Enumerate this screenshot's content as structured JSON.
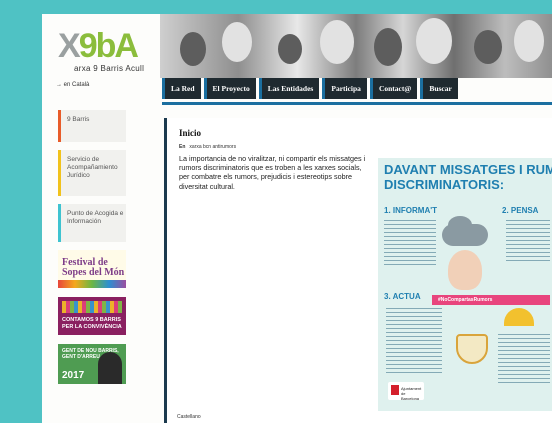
{
  "header": {
    "logo_mark": "X9bA",
    "logo_sub": "arxa 9 Barris Acull"
  },
  "language": "→ en Català",
  "nav": [
    "La Red",
    "El Proyecto",
    "Las Entidades",
    "Participa",
    "Contact@",
    "Buscar"
  ],
  "sidebar": {
    "items": [
      {
        "label": "9 Barris"
      },
      {
        "label": "Servicio de Acompañamiento Jurídico"
      },
      {
        "label": "Punto de Acogida e Información"
      }
    ],
    "promos": [
      {
        "text": "Festival de Sopes del Món"
      },
      {
        "text": "CONTAMOS 9 BARRIS PER LA CONVIVÈNCIA"
      },
      {
        "text": "GENT DE NOU BARRIS, GENT D'ARREU",
        "year": "2017"
      }
    ]
  },
  "content": {
    "title": "Inicio",
    "meta_tag": "En",
    "meta_author": "xarxa bcn antirumors",
    "body": "La importancia de no viralitzar, ni compartir els missatges i rumors discriminatoris que es troben a les xarxes socials, per combatre els rumors, prejudicis i estereotips sobre diversitat cultural.",
    "footer": "Castellano"
  },
  "poster": {
    "heading1": "DAVANT MISSATGES I RUM",
    "heading2": "DISCRIMINATORIS:",
    "step1": "1. INFORMA'T",
    "step2": "2. PENSA",
    "step3": "3. ACTUA",
    "hashtag": "#NoCompartasRumors",
    "city": "Ajuntament de Barcelona"
  }
}
